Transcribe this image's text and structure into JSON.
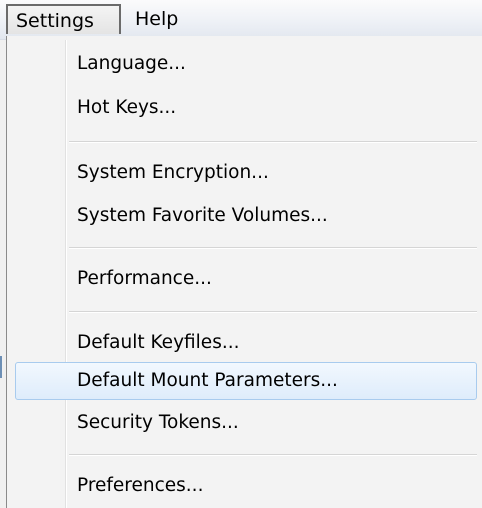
{
  "menubar": {
    "items": [
      {
        "label": "Settings"
      },
      {
        "label": "Help"
      }
    ]
  },
  "dropdown": {
    "items": [
      {
        "label": "Language..."
      },
      {
        "label": "Hot Keys..."
      },
      {
        "label": "System Encryption..."
      },
      {
        "label": "System Favorite Volumes..."
      },
      {
        "label": "Performance..."
      },
      {
        "label": "Default Keyfiles..."
      },
      {
        "label": "Default Mount Parameters...",
        "highlighted": true
      },
      {
        "label": "Security Tokens..."
      },
      {
        "label": "Preferences..."
      }
    ]
  },
  "colors": {
    "menu_background": "#f3f3f3",
    "highlight_border": "#a8cbee",
    "highlight_fill": "#deecfb",
    "separator": "#d5d5d5"
  }
}
